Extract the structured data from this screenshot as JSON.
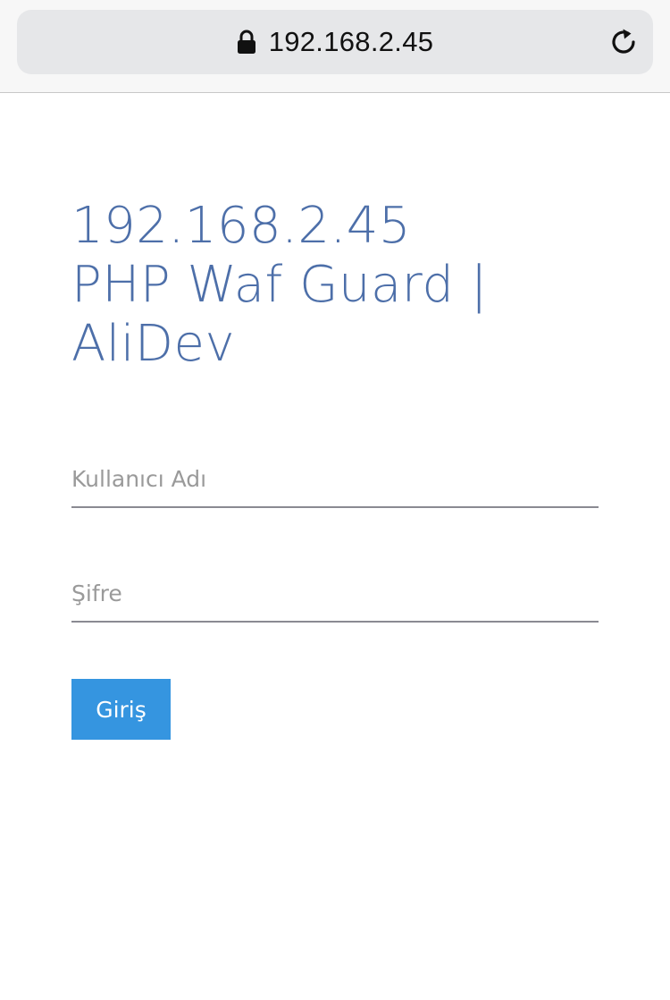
{
  "browser": {
    "url": "192.168.2.45",
    "lock_icon": "lock-icon",
    "reload_icon": "reload-icon"
  },
  "page": {
    "title_lines": [
      "192.168.2.45",
      "PHP Waf Guard |",
      "AliDev"
    ],
    "title_color": "#4d6fa9"
  },
  "form": {
    "username": {
      "value": "",
      "placeholder": "Kullanıcı Adı"
    },
    "password": {
      "value": "",
      "placeholder": "Şifre"
    },
    "submit_label": "Giriş",
    "button_color": "#3595e0"
  }
}
